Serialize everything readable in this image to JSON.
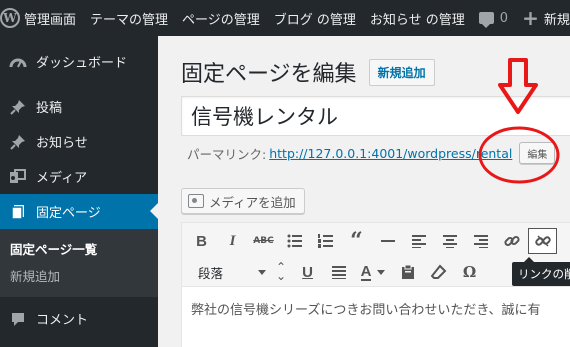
{
  "adminbar": {
    "items": [
      {
        "label": "管理画面"
      },
      {
        "label": "テーマの管理"
      },
      {
        "label": "ページの管理"
      },
      {
        "label": "ブログ の管理"
      },
      {
        "label": "お知らせ の管理"
      }
    ],
    "comment_count": "0",
    "new_label": "新規"
  },
  "sidebar": {
    "items": [
      {
        "label": "ダッシュボード",
        "icon": "dashboard-icon"
      },
      {
        "label": "投稿",
        "icon": "pin-icon"
      },
      {
        "label": "お知らせ",
        "icon": "pin-icon"
      },
      {
        "label": "メディア",
        "icon": "media-icon"
      },
      {
        "label": "固定ページ",
        "icon": "page-icon"
      },
      {
        "label": "コメント",
        "icon": "comment-icon"
      }
    ],
    "submenu": {
      "active": "固定ページ一覧",
      "add_new": "新規追加"
    }
  },
  "main": {
    "page_title": "固定ページを編集",
    "add_new": "新規追加",
    "post_title": "信号機レンタル",
    "permalink_label": "パーマリンク:",
    "permalink_url": "http://127.0.0.1:4001/wordpress/rental",
    "edit_label": "編集",
    "add_media": "メディアを追加",
    "format_select": "段落",
    "tooltip": "リンクの削",
    "content": "弊社の信号機シリーズにつきお問い合わせいただき、誠に有"
  },
  "colors": {
    "adminbar_bg": "#23282d",
    "sidebar_current": "#0073aa",
    "link": "#0073aa",
    "annotation_red": "#e81818"
  }
}
